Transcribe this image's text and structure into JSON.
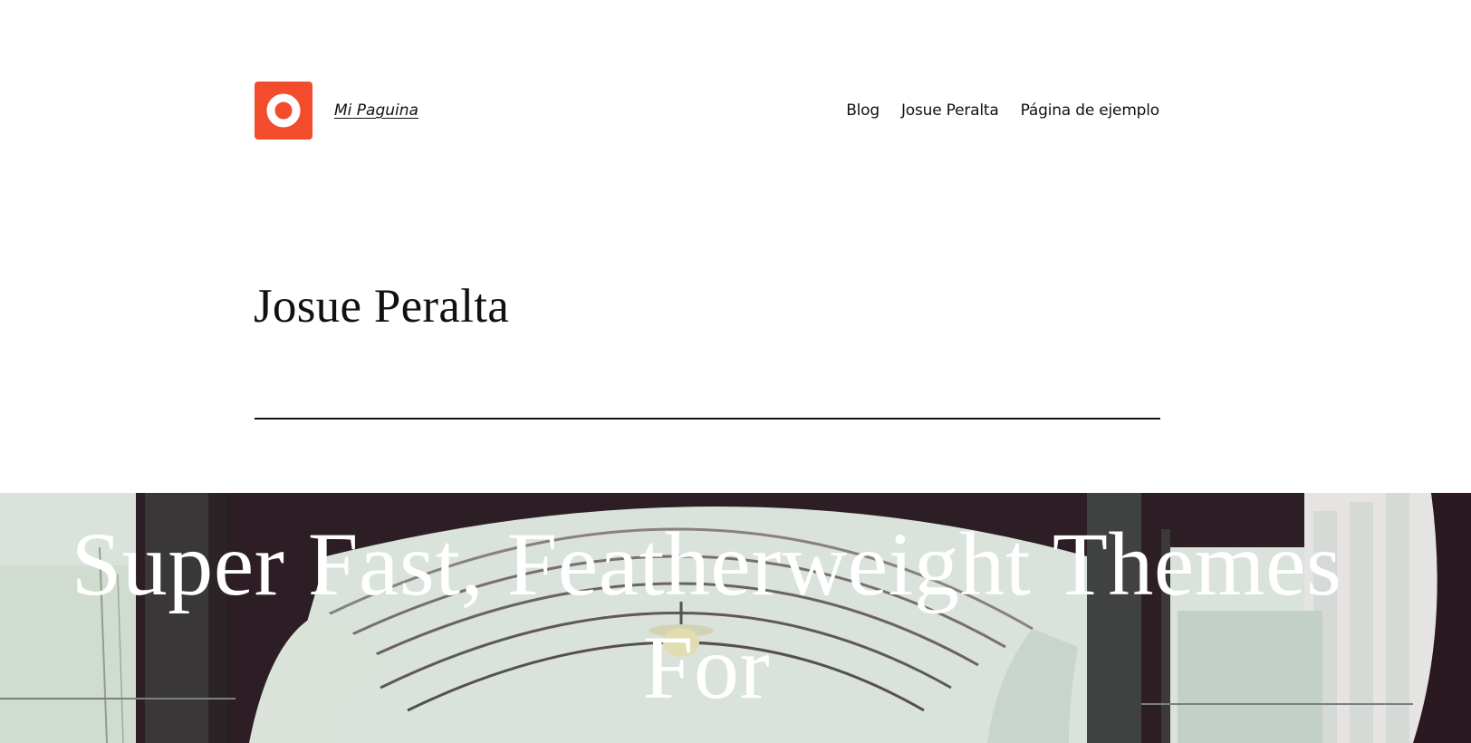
{
  "site": {
    "title": "Mi Paguina",
    "logo_icon": "ring-logo-icon",
    "logo_color": "#f24c2c"
  },
  "nav": {
    "items": [
      {
        "label": "Blog"
      },
      {
        "label": "Josue Peralta"
      },
      {
        "label": "Página de ejemplo"
      }
    ]
  },
  "page": {
    "title": "Josue Peralta"
  },
  "hero": {
    "heading": "Super Fast, Featherweight Themes For"
  }
}
